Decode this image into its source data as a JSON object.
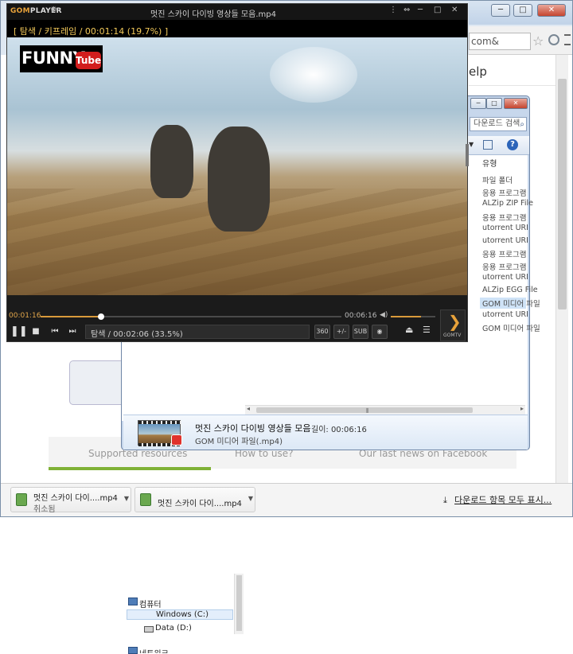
{
  "browser": {
    "address_partial": "com&",
    "help_link": "elp",
    "buttons": {
      "minimize": "─",
      "maximize": "□",
      "close": "✕"
    }
  },
  "page": {
    "tabs": [
      "Supported resources",
      "How to use?",
      "Our last news on Facebook"
    ]
  },
  "downloads": {
    "items": [
      {
        "name": "멋진 스카이 다이....mp4",
        "status": "취소됨"
      },
      {
        "name": "멋진 스카이 다이....mp4",
        "status": ""
      }
    ],
    "show_all": "다운로드 항목 모두 표시..."
  },
  "explorer": {
    "search_placeholder": "다운로드 검색",
    "type_header": "유형",
    "types": [
      "파일 폴더",
      "응용 프로그램",
      "ALZip ZIP File",
      "응용 프로그램",
      "utorrent URI",
      "utorrent URI",
      "응용 프로그램",
      "응용 프로그램",
      "utorrent URI",
      "ALZip EGG File",
      "GOM 미디어 파일",
      "utorrent URI",
      "GOM 미디어 파일"
    ],
    "nav": {
      "computer": "컴퓨터",
      "drive_c": "Windows (C:)",
      "drive_d": "Data (D:)",
      "network": "네트워크"
    },
    "details": {
      "name": "멋진 스카이 다이빙 영상들 모음",
      "length": "길이: 00:06:16",
      "type": "GOM 미디어 파일(.mp4)"
    }
  },
  "player": {
    "logo_a": "GOM",
    "logo_b": "PLAYER",
    "filename": "멋진 스카이 다이빙 영상들 모음.mp4",
    "osd": "[ 탐색 / 키프레임 / 00:01:14 (19.7%) ]",
    "brand_text": "FUNNY",
    "brand_tube": "Tube",
    "time_current": "00:01:16",
    "time_total": "00:06:16",
    "seek_progress": 0.2,
    "volume_level": 0.68,
    "status": "탐색 / 00:02:06 (33.5%)",
    "tools": [
      "360",
      "+/-",
      "SUB",
      "◉",
      "✲"
    ],
    "gomtv": "GOMTV",
    "accent": "#e8a23a"
  }
}
